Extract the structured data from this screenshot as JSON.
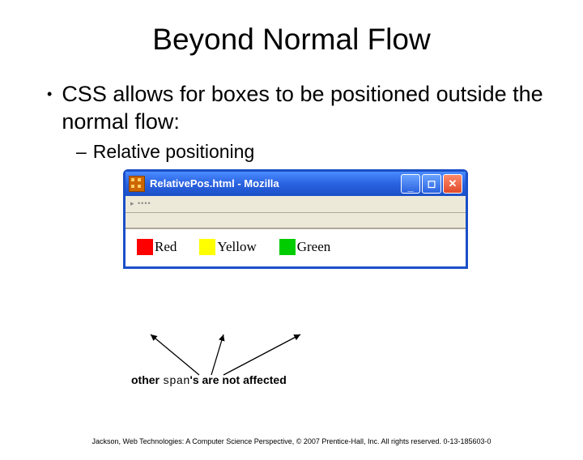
{
  "title": "Beyond Normal Flow",
  "bullet": "CSS allows for boxes to be positioned outside the normal flow:",
  "subbullet": "Relative positioning",
  "window": {
    "title": "RelativePos.html - Mozilla",
    "items": [
      {
        "label": "Red",
        "color": "#ff0000"
      },
      {
        "label": "Yellow",
        "color": "#ffff00"
      },
      {
        "label": "Green",
        "color": "#00cc00"
      }
    ]
  },
  "annotation": {
    "prefix": "other ",
    "code": "span",
    "suffix": "'s are not affected"
  },
  "footer": "Jackson, Web Technologies: A Computer Science Perspective, © 2007 Prentice-Hall, Inc. All rights reserved. 0-13-185603-0"
}
